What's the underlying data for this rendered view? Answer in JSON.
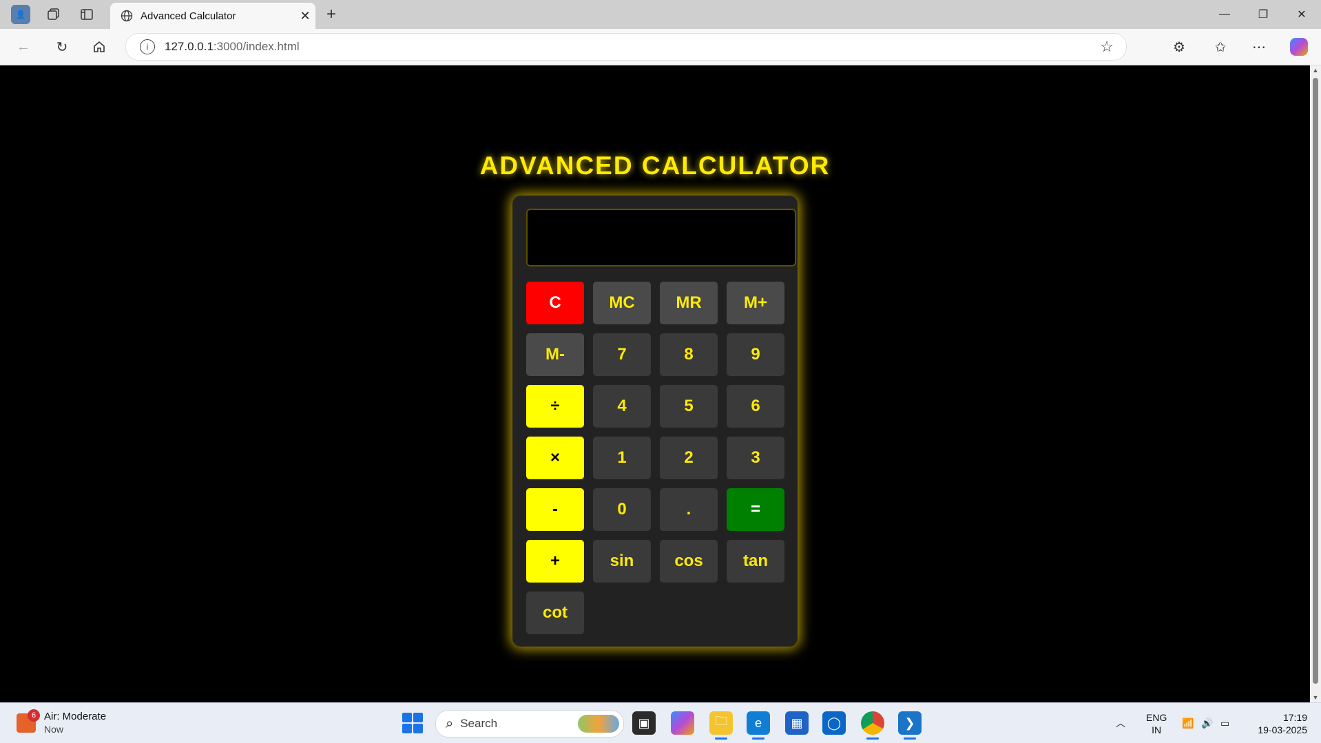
{
  "browser": {
    "tab_title": "Advanced Calculator",
    "url_host": "127.0.0.1",
    "url_rest": ":3000/index.html"
  },
  "page": {
    "title": "ADVANCED CALCULATOR",
    "display_value": ""
  },
  "keys": [
    {
      "label": "C",
      "kind": "clear",
      "name": "clear-button"
    },
    {
      "label": "MC",
      "kind": "memory",
      "name": "memory-clear-button"
    },
    {
      "label": "MR",
      "kind": "memory",
      "name": "memory-recall-button"
    },
    {
      "label": "M+",
      "kind": "memory",
      "name": "memory-add-button"
    },
    {
      "label": "M-",
      "kind": "memory",
      "name": "memory-subtract-button"
    },
    {
      "label": "7",
      "kind": "num",
      "name": "digit-7-button"
    },
    {
      "label": "8",
      "kind": "num",
      "name": "digit-8-button"
    },
    {
      "label": "9",
      "kind": "num",
      "name": "digit-9-button"
    },
    {
      "label": "÷",
      "kind": "op",
      "name": "divide-button"
    },
    {
      "label": "4",
      "kind": "num",
      "name": "digit-4-button"
    },
    {
      "label": "5",
      "kind": "num",
      "name": "digit-5-button"
    },
    {
      "label": "6",
      "kind": "num",
      "name": "digit-6-button"
    },
    {
      "label": "×",
      "kind": "op",
      "name": "multiply-button"
    },
    {
      "label": "1",
      "kind": "num",
      "name": "digit-1-button"
    },
    {
      "label": "2",
      "kind": "num",
      "name": "digit-2-button"
    },
    {
      "label": "3",
      "kind": "num",
      "name": "digit-3-button"
    },
    {
      "label": "-",
      "kind": "op",
      "name": "subtract-button"
    },
    {
      "label": "0",
      "kind": "num",
      "name": "digit-0-button"
    },
    {
      "label": ".",
      "kind": "num",
      "name": "decimal-button"
    },
    {
      "label": "=",
      "kind": "equals",
      "name": "equals-button"
    },
    {
      "label": "+",
      "kind": "op",
      "name": "add-button"
    },
    {
      "label": "sin",
      "kind": "num",
      "name": "sin-button"
    },
    {
      "label": "cos",
      "kind": "num",
      "name": "cos-button"
    },
    {
      "label": "tan",
      "kind": "num",
      "name": "tan-button"
    },
    {
      "label": "cot",
      "kind": "num",
      "name": "cot-button"
    }
  ],
  "taskbar": {
    "weather_badge": "6",
    "weather_title": "Air: Moderate",
    "weather_sub": "Now",
    "search_placeholder": "Search",
    "lang_top": "ENG",
    "lang_bottom": "IN",
    "time": "17:19",
    "date": "19-03-2025"
  },
  "colors": {
    "accent_yellow": "#ffeb00",
    "clear_red": "#ff0000",
    "equals_green": "#008000"
  }
}
